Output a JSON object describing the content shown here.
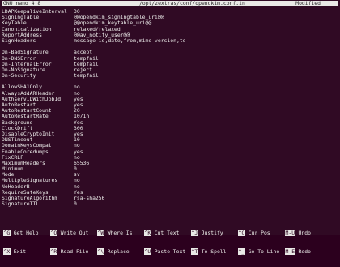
{
  "titlebar": {
    "app": "GNU nano 4.8",
    "file": "/opt/zextras/conf/opendkim.conf.in",
    "status": "Modified"
  },
  "config_lines": [
    {
      "key": "LDAPKeepaliveInterval",
      "value": "30"
    },
    {
      "key": "SigningTable",
      "value": "@@opendkim_signingtable_uri@@"
    },
    {
      "key": "KeyTable",
      "value": "@@opendkim_keytable_uri@@"
    },
    {
      "key": "Canonicalization",
      "value": "relaxed/relaxed"
    },
    {
      "key": "ReportAddress",
      "value": "@@av_notify_user@@"
    },
    {
      "key": "SignHeaders",
      "value": "message-id,date,from,mime-version,to"
    },
    {
      "key": "",
      "value": ""
    },
    {
      "key": "On-BadSignature",
      "value": "accept"
    },
    {
      "key": "On-DNSError",
      "value": "tempfail"
    },
    {
      "key": "On-InternalError",
      "value": "tempfail"
    },
    {
      "key": "On-NoSignature",
      "value": "reject"
    },
    {
      "key": "On-Security",
      "value": "tempfail"
    },
    {
      "key": "",
      "value": ""
    },
    {
      "key": "AllowSHA1Only",
      "value": "no"
    },
    {
      "key": "AlwaysAddARHeader",
      "value": "no"
    },
    {
      "key": "AuthservIDWithJobId",
      "value": "yes"
    },
    {
      "key": "AutoRestart",
      "value": "yes"
    },
    {
      "key": "AutoRestartCount",
      "value": "20"
    },
    {
      "key": "AutoRestartRate",
      "value": "10/1h"
    },
    {
      "key": "Background",
      "value": "Yes"
    },
    {
      "key": "ClockDrift",
      "value": "300"
    },
    {
      "key": "DisableCryptoInit",
      "value": "yes"
    },
    {
      "key": "DNSTimeout",
      "value": "10"
    },
    {
      "key": "DomainKeysCompat",
      "value": "no"
    },
    {
      "key": "EnableCoredumps",
      "value": "yes"
    },
    {
      "key": "FixCRLF",
      "value": "no"
    },
    {
      "key": "MaximumHeaders",
      "value": "65536"
    },
    {
      "key": "Minimum",
      "value": "0"
    },
    {
      "key": "Mode",
      "value": "sv"
    },
    {
      "key": "MultipleSignatures",
      "value": "no"
    },
    {
      "key": "NoHeaderB",
      "value": "no"
    },
    {
      "key": "RequireSafeKeys",
      "value": "Yes"
    },
    {
      "key": "SignatureAlgorithm",
      "value": "rsa-sha256"
    },
    {
      "key": "SignatureTTL",
      "value": "0"
    }
  ],
  "shortcuts_row1": [
    {
      "key": "^G",
      "label": "Get Help"
    },
    {
      "key": "^O",
      "label": "Write Out"
    },
    {
      "key": "^W",
      "label": "Where Is"
    },
    {
      "key": "^K",
      "label": "Cut Text"
    },
    {
      "key": "^J",
      "label": "Justify"
    },
    {
      "key": "^C",
      "label": "Cur Pos"
    },
    {
      "key": "M-U",
      "label": "Undo"
    }
  ],
  "shortcuts_row2": [
    {
      "key": "^X",
      "label": "Exit"
    },
    {
      "key": "^R",
      "label": "Read File"
    },
    {
      "key": "^\\",
      "label": "Replace"
    },
    {
      "key": "^U",
      "label": "Paste Text"
    },
    {
      "key": "^T",
      "label": "To Spell"
    },
    {
      "key": "^_",
      "label": "Go To Line"
    },
    {
      "key": "M-E",
      "label": "Redo"
    }
  ]
}
